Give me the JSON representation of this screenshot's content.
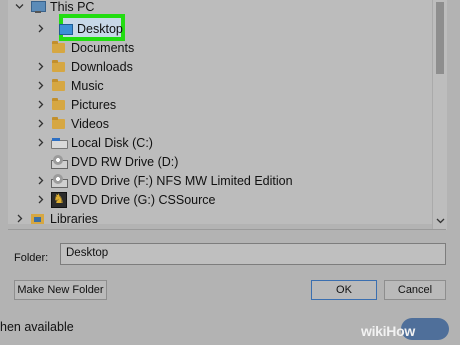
{
  "tree": {
    "items": [
      {
        "label": "This PC",
        "icon": "pc-icon",
        "expander": "expanded"
      },
      {
        "label": "Desktop",
        "icon": "desktop-folder-icon",
        "expander": "collapsed",
        "selected": true
      },
      {
        "label": "Documents",
        "icon": "documents-folder-icon",
        "expander": "none"
      },
      {
        "label": "Downloads",
        "icon": "downloads-folder-icon",
        "expander": "collapsed"
      },
      {
        "label": "Music",
        "icon": "music-folder-icon",
        "expander": "collapsed"
      },
      {
        "label": "Pictures",
        "icon": "pictures-folder-icon",
        "expander": "collapsed"
      },
      {
        "label": "Videos",
        "icon": "videos-folder-icon",
        "expander": "collapsed"
      },
      {
        "label": "Local Disk (C:)",
        "icon": "local-disk-icon",
        "expander": "collapsed"
      },
      {
        "label": "DVD RW Drive (D:)",
        "icon": "dvd-drive-icon",
        "expander": "none"
      },
      {
        "label": "DVD Drive (F:) NFS MW Limited Edition",
        "icon": "dvd-drive-icon",
        "expander": "collapsed"
      },
      {
        "label": "DVD Drive (G:) CSSource",
        "icon": "cssource-icon",
        "expander": "collapsed"
      },
      {
        "label": "Libraries",
        "icon": "libraries-icon",
        "expander": "collapsed"
      }
    ]
  },
  "folder": {
    "label": "Folder:",
    "value": "Desktop"
  },
  "buttons": {
    "make_new_folder": "Make New Folder",
    "ok": "OK",
    "cancel": "Cancel"
  },
  "status_text": "hen available",
  "watermark": {
    "wiki": "wiki",
    "how": "How"
  },
  "colors": {
    "highlight": "#22dd11",
    "accent": "#3b6fb0"
  }
}
